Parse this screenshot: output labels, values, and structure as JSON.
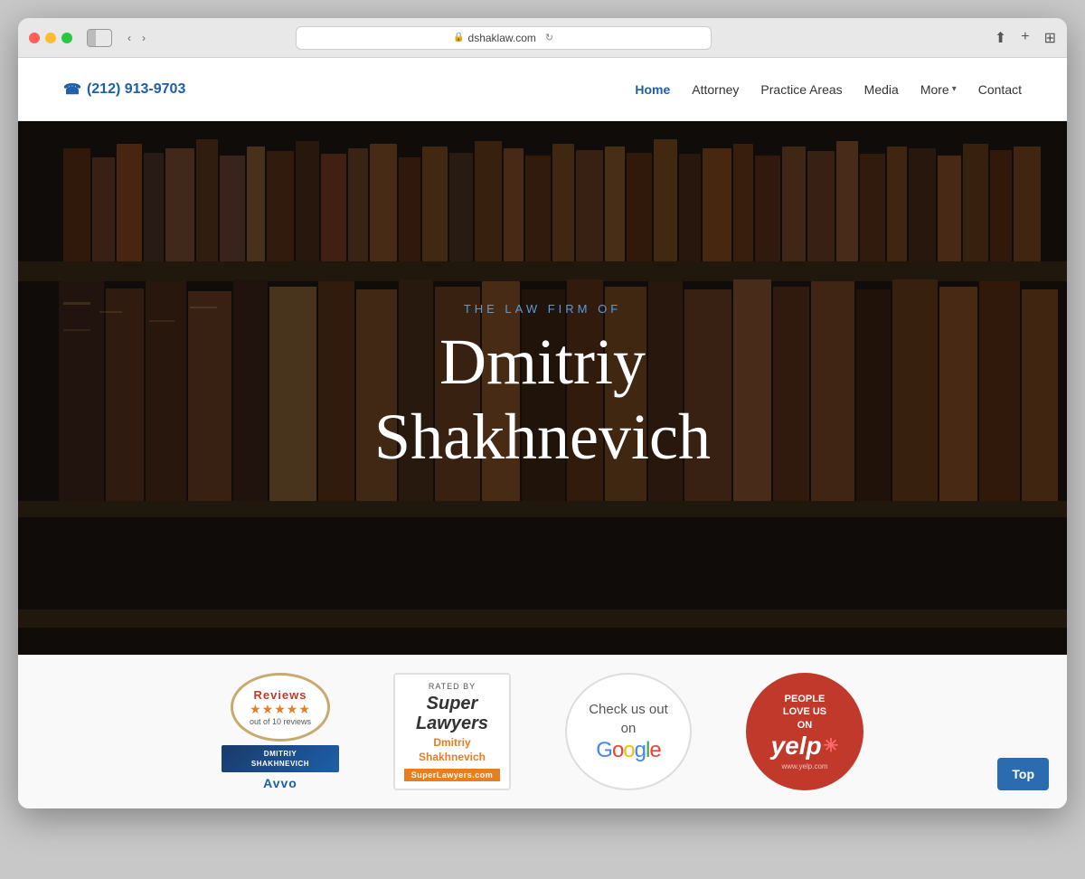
{
  "browser": {
    "url": "dshaklaw.com",
    "dots": [
      "red",
      "yellow",
      "green"
    ]
  },
  "header": {
    "phone_icon": "☎",
    "phone": "(212) 913-9703",
    "nav": [
      {
        "label": "Home",
        "active": true
      },
      {
        "label": "Attorney",
        "active": false
      },
      {
        "label": "Practice Areas",
        "active": false
      },
      {
        "label": "Media",
        "active": false
      },
      {
        "label": "More",
        "active": false
      },
      {
        "label": "Contact",
        "active": false
      }
    ]
  },
  "hero": {
    "subtitle": "THE LAW FIRM OF",
    "title_line1": "Dmitriy",
    "title_line2": "Shakhnevich"
  },
  "badges": {
    "avvo": {
      "reviews_label": "Reviews",
      "stars": "★★★★★",
      "count": "out of 10 reviews",
      "name": "DMITRIY SHAKHNEVICH",
      "wordmark": "Avvo"
    },
    "super_lawyers": {
      "rated_by": "RATED BY",
      "title": "Super Lawyers",
      "name": "Dmitriy Shakhnevich",
      "website": "SuperLawyers.com"
    },
    "google": {
      "line1": "Check us out",
      "line2": "on",
      "wordmark_letters": [
        "G",
        "o",
        "o",
        "g",
        "l",
        "e"
      ]
    },
    "yelp": {
      "line1": "PEOPLE",
      "line2": "LOVE US",
      "line3": "ON",
      "wordmark": "yelp",
      "website": "www.yelp.com"
    }
  },
  "top_button": {
    "label": "Top"
  },
  "colors": {
    "brand_blue": "#1e5fa8",
    "nav_active": "#1e5fa8",
    "yelp_red": "#c0392b",
    "top_btn_blue": "#2b6cb0",
    "hero_subtitle": "#5b9bd5"
  }
}
